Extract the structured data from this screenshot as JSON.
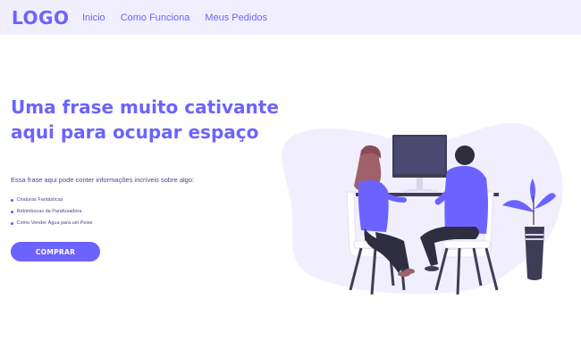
{
  "header": {
    "logo": "LOGO",
    "nav": [
      "Inicio",
      "Como Funciona",
      "Meus Pedidos"
    ]
  },
  "hero": {
    "title_line1": "Uma frase muito cativante",
    "title_line2": "aqui para ocupar espaço",
    "subtitle": "Essa frase aqui pode conter informações incríveis sobre algo:",
    "features": [
      "Criaturas Fantásticas",
      "Rebimbocas da Parafusadora",
      "Como Vender Água para um Peixe"
    ],
    "button_label": "COMPRAR"
  },
  "colors": {
    "accent": "#6c63ff",
    "header_bg": "#f1effd",
    "blob": "#f1effd"
  },
  "illustration": {
    "icons": [
      "people-at-desk-illustration",
      "potted-plant-icon"
    ]
  }
}
